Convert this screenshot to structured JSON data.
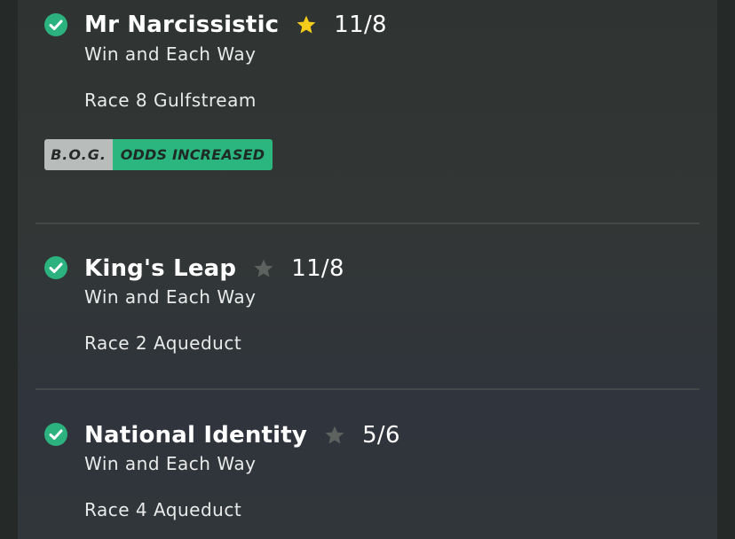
{
  "selections": [
    {
      "name": "Mr Narcissistic",
      "star": "star-filled",
      "odds": "11/8",
      "market": "Win and Each Way",
      "race": "Race 8 Gulfstream",
      "badges": {
        "bog": "B.O.G.",
        "odds_increased": "ODDS INCREASED"
      }
    },
    {
      "name": "King's Leap",
      "star": "star-outline",
      "odds": "11/8",
      "market": "Win and Each Way",
      "race": "Race 2 Aqueduct"
    },
    {
      "name": "National Identity",
      "star": "star-outline",
      "odds": "5/6",
      "market": "Win and Each Way",
      "race": "Race 4 Aqueduct"
    }
  ],
  "colors": {
    "check": "#2bb27f",
    "star_active": "#f5cc1a",
    "star_inactive": "#5d625f",
    "bog_badge": "#b8bcbb",
    "odds_increased_badge": "#2bb67f"
  }
}
